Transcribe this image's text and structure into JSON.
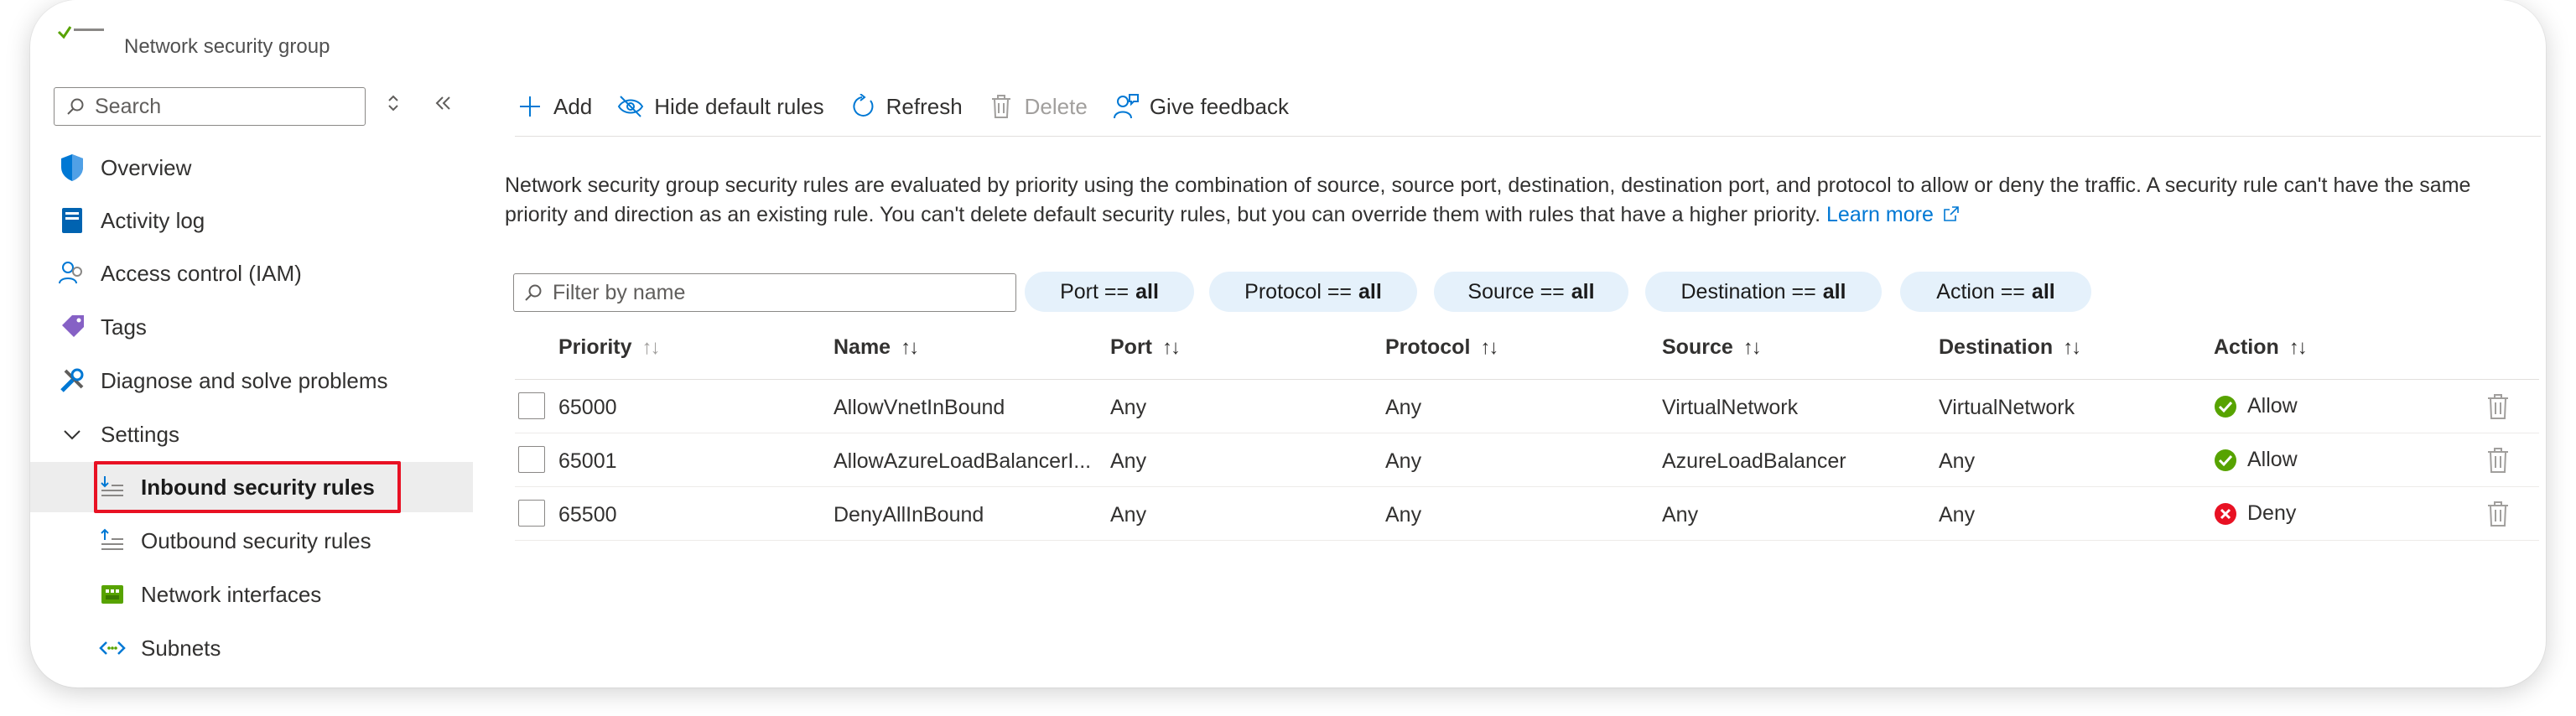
{
  "header": {
    "subtitle": "Network security group"
  },
  "sidebar": {
    "search_placeholder": "Search",
    "items": [
      {
        "label": "Overview",
        "icon": "shield-icon"
      },
      {
        "label": "Activity log",
        "icon": "activity-log-icon"
      },
      {
        "label": "Access control (IAM)",
        "icon": "people-icon"
      },
      {
        "label": "Tags",
        "icon": "tag-icon"
      },
      {
        "label": "Diagnose and solve problems",
        "icon": "wrench-icon"
      },
      {
        "label": "Settings",
        "icon": "chevron-down-icon"
      },
      {
        "label": "Inbound security rules",
        "icon": "inbound-rules-icon",
        "selected": true
      },
      {
        "label": "Outbound security rules",
        "icon": "outbound-rules-icon"
      },
      {
        "label": "Network interfaces",
        "icon": "network-interface-icon"
      },
      {
        "label": "Subnets",
        "icon": "subnet-icon"
      }
    ]
  },
  "toolbar": {
    "add": "Add",
    "hide_default": "Hide default rules",
    "refresh": "Refresh",
    "delete": "Delete",
    "feedback": "Give feedback"
  },
  "description": {
    "text": "Network security group security rules are evaluated by priority using the combination of source, source port, destination, destination port, and protocol to allow or deny the traffic. A security rule can't have the same priority and direction as an existing rule. You can't delete default security rules, but you can override them with rules that have a higher priority.",
    "link": "Learn more"
  },
  "filters": {
    "name_placeholder": "Filter by name",
    "pills": [
      {
        "label": "Port ==",
        "value": "all"
      },
      {
        "label": "Protocol ==",
        "value": "all"
      },
      {
        "label": "Source ==",
        "value": "all"
      },
      {
        "label": "Destination ==",
        "value": "all"
      },
      {
        "label": "Action ==",
        "value": "all"
      }
    ]
  },
  "table": {
    "columns": [
      "Priority",
      "Name",
      "Port",
      "Protocol",
      "Source",
      "Destination",
      "Action"
    ],
    "rows": [
      {
        "priority": "65000",
        "name": "AllowVnetInBound",
        "port": "Any",
        "protocol": "Any",
        "source": "VirtualNetwork",
        "destination": "VirtualNetwork",
        "action": "Allow"
      },
      {
        "priority": "65001",
        "name": "AllowAzureLoadBalancerI...",
        "port": "Any",
        "protocol": "Any",
        "source": "AzureLoadBalancer",
        "destination": "Any",
        "action": "Allow"
      },
      {
        "priority": "65500",
        "name": "DenyAllInBound",
        "port": "Any",
        "protocol": "Any",
        "source": "Any",
        "destination": "Any",
        "action": "Deny"
      }
    ]
  },
  "colors": {
    "accent": "#0078d4",
    "allow": "#57a300",
    "deny": "#e81123",
    "highlight": "#e81123",
    "pill_bg": "#e5f1fb"
  }
}
